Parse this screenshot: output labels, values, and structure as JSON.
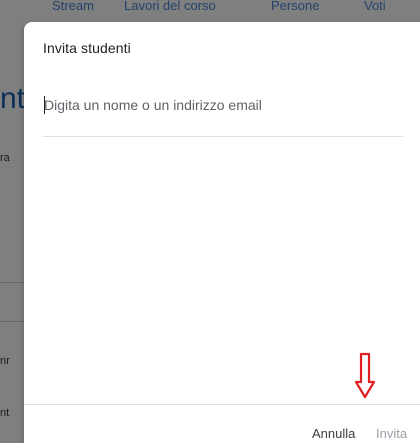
{
  "background": {
    "nav_tabs": [
      "Stream",
      "Lavori del corso",
      "Persone",
      "Voti"
    ],
    "fragments": {
      "big_letters": "nt",
      "small_1": "ra",
      "small_2": "nr",
      "small_3": "nt"
    }
  },
  "dialog": {
    "title": "Invita studenti",
    "search": {
      "placeholder": "Digita un nome o un indirizzo email",
      "value": ""
    },
    "buttons": {
      "cancel": "Annulla",
      "invite": "Invita"
    },
    "invite_enabled": false
  },
  "annotation": {
    "icon": "red-down-arrow",
    "color": "#e02020"
  },
  "colors": {
    "overlay": "#7f7f7f",
    "tab_text": "#25426b",
    "disabled_text": "#9aa0a6"
  }
}
